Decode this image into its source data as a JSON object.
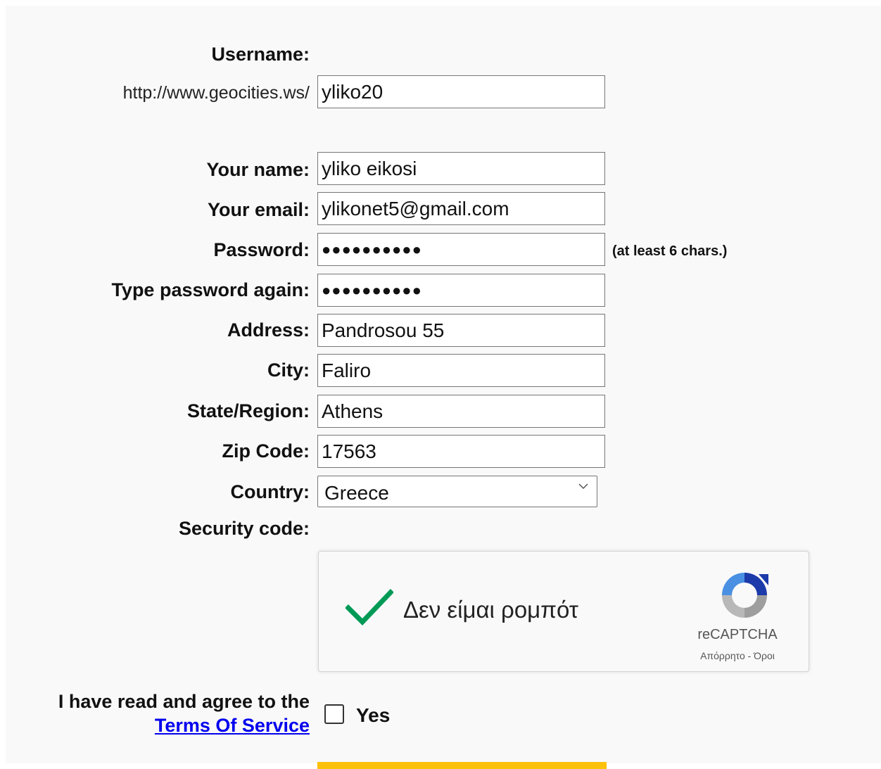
{
  "username": {
    "label": "Username:",
    "prefix": "http://www.geocities.ws/",
    "value": "yliko20"
  },
  "fields": {
    "name_label": "Your name:",
    "name_value": "yliko eikosi",
    "email_label": "Your email:",
    "email_value": "ylikonet5@gmail.com",
    "password_label": "Password:",
    "password_mask": "●●●●●●●●●●",
    "password_hint": "(at least 6 chars.)",
    "password2_label": "Type password again:",
    "password2_mask": "●●●●●●●●●●",
    "address_label": "Address:",
    "address_value": "Pandrosou 55",
    "city_label": "City:",
    "city_value": "Faliro",
    "state_label": "State/Region:",
    "state_value": "Athens",
    "zip_label": "Zip Code:",
    "zip_value": "17563",
    "country_label": "Country:",
    "country_value": "Greece"
  },
  "security": {
    "label": "Security code:",
    "captcha_text": "Δεν είμαι ρομπότ",
    "captcha_brand": "reCAPTCHA",
    "captcha_links": "Απόρρητο - Όροι",
    "checked": true
  },
  "terms": {
    "line1": "I have read and agree to the",
    "link": "Terms Of Service",
    "yes_label": "Yes"
  },
  "colors": {
    "submit": "#fcc10a",
    "check": "#009a57",
    "link": "#0000ee"
  }
}
